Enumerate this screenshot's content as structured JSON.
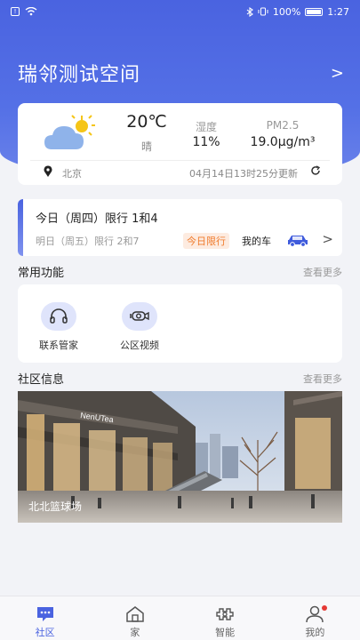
{
  "status_bar": {
    "battery": "100%",
    "time": "1:27"
  },
  "header": {
    "title": "瑞邻测试空间",
    "chevron": ">"
  },
  "weather": {
    "icon": "partly-cloudy-icon",
    "temperature": "20℃",
    "condition": "晴",
    "humidity_label": "湿度",
    "humidity_value": "11%",
    "pm_label": "PM2.5",
    "pm_value": "19.0μg/m³",
    "city": "北京",
    "updated": "04月14日13时25分更新"
  },
  "restriction": {
    "today": "今日（周四）限行 1和4",
    "tomorrow": "明日（周五）限行 2和7",
    "badge": "今日限行",
    "my_car": "我的车",
    "chevron": ">"
  },
  "common": {
    "title": "常用功能",
    "more": "查看更多",
    "items": [
      {
        "label": "联系管家",
        "icon": "headset-icon"
      },
      {
        "label": "公区视频",
        "icon": "camera-icon"
      }
    ]
  },
  "community": {
    "title": "社区信息",
    "more": "查看更多",
    "caption": "北北篮球场",
    "sign_text": "NenUTea"
  },
  "tabbar": {
    "items": [
      {
        "label": "社区",
        "icon": "community-icon",
        "active": true
      },
      {
        "label": "家",
        "icon": "home-icon",
        "active": false
      },
      {
        "label": "智能",
        "icon": "smart-icon",
        "active": false
      },
      {
        "label": "我的",
        "icon": "profile-icon",
        "active": false
      }
    ]
  },
  "colors": {
    "accent": "#4a63e0",
    "badge": "#f07b2c",
    "notify": "#e53935"
  }
}
